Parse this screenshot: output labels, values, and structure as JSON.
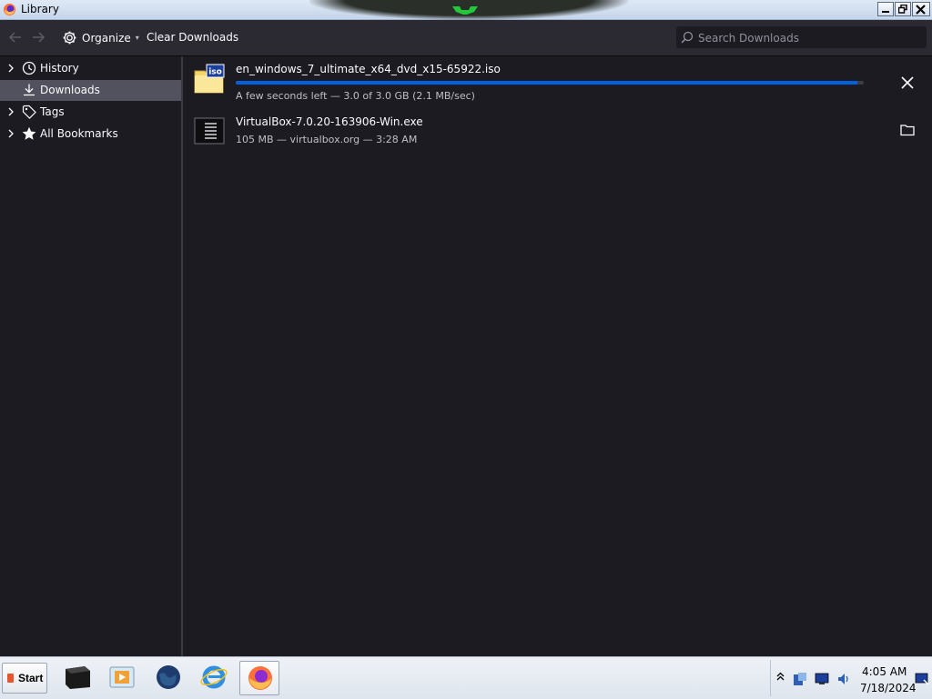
{
  "window": {
    "title": "Library"
  },
  "toolbar": {
    "organize_label": "Organize",
    "clear_label": "Clear Downloads",
    "search_placeholder": "Search Downloads"
  },
  "sidebar": {
    "items": [
      {
        "label": "History",
        "icon": "clock-icon",
        "expandable": true,
        "selected": false
      },
      {
        "label": "Downloads",
        "icon": "download-icon",
        "expandable": false,
        "selected": true
      },
      {
        "label": "Tags",
        "icon": "tag-icon",
        "expandable": true,
        "selected": false
      },
      {
        "label": "All Bookmarks",
        "icon": "star-icon",
        "expandable": true,
        "selected": false
      }
    ]
  },
  "downloads": [
    {
      "name": "en_windows_7_ultimate_x64_dvd_x15-65922.iso",
      "status": "A few seconds left — 3.0 of 3.0 GB (2.1 MB/sec)",
      "icon": "iso-file-icon",
      "progress": 0.99,
      "action": "cancel"
    },
    {
      "name": "VirtualBox-7.0.20-163906-Win.exe",
      "status": "105 MB — virtualbox.org — 3:28 AM",
      "icon": "exe-file-icon",
      "action": "open-folder"
    }
  ],
  "taskbar": {
    "start_label": "Start",
    "apps": [
      "terminal-icon",
      "media-player-icon",
      "globe-icon",
      "internet-explorer-icon",
      "firefox-icon"
    ],
    "clock": {
      "time": "4:05 AM",
      "date": "7/18/2024"
    }
  },
  "colors": {
    "accent": "#0060df",
    "background": "#1c1b22",
    "toolbar": "#2b2a33",
    "selected": "#52525e"
  }
}
